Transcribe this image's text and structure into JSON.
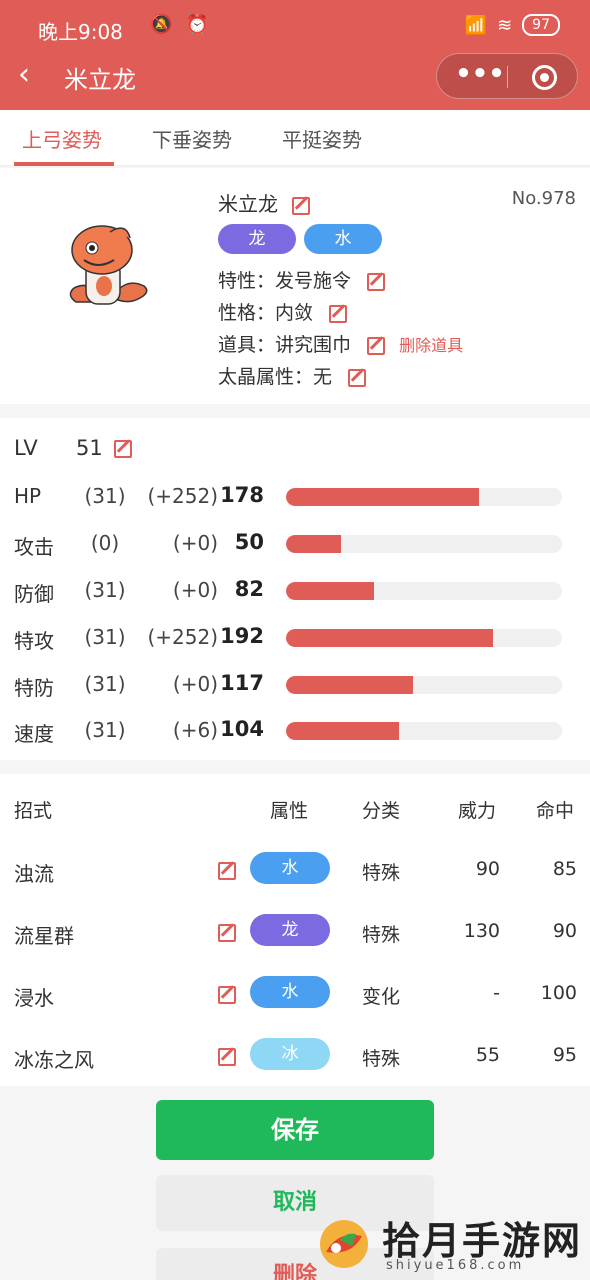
{
  "status_bar": {
    "time": "晚上9:08",
    "battery": "97"
  },
  "header": {
    "title": "米立龙"
  },
  "tabs": [
    {
      "label": "上弓姿势",
      "active": true
    },
    {
      "label": "下垂姿势",
      "active": false
    },
    {
      "label": "平挺姿势",
      "active": false
    }
  ],
  "pokemon": {
    "name": "米立龙",
    "number": "No.978",
    "types": [
      {
        "label": "龙",
        "color": "#7a6be0"
      },
      {
        "label": "水",
        "color": "#4a9ff0"
      }
    ],
    "ability": "特性：发号施令",
    "nature": "性格：内敛",
    "item": "道具：讲究围巾",
    "remove_item": "删除道具",
    "tera_type": "太晶属性：无"
  },
  "level": {
    "label": "LV",
    "value": "51"
  },
  "stats": [
    {
      "name": "HP",
      "iv": "(31)",
      "ev": "(+252)",
      "value": "178",
      "fill": 0.7
    },
    {
      "name": "攻击",
      "iv": "(0)",
      "ev": "(+0)",
      "value": "50",
      "fill": 0.2
    },
    {
      "name": "防御",
      "iv": "(31)",
      "ev": "(+0)",
      "value": "82",
      "fill": 0.32
    },
    {
      "name": "特攻",
      "iv": "(31)",
      "ev": "(+252)",
      "value": "192",
      "fill": 0.75
    },
    {
      "name": "特防",
      "iv": "(31)",
      "ev": "(+0)",
      "value": "117",
      "fill": 0.46
    },
    {
      "name": "速度",
      "iv": "(31)",
      "ev": "(+6)",
      "value": "104",
      "fill": 0.41
    }
  ],
  "moves_header": {
    "move": "招式",
    "type": "属性",
    "category": "分类",
    "power": "威力",
    "accuracy": "命中"
  },
  "moves": [
    {
      "name": "浊流",
      "type": "水",
      "type_color": "#4a9ff0",
      "category": "特殊",
      "power": "90",
      "accuracy": "85"
    },
    {
      "name": "流星群",
      "type": "龙",
      "type_color": "#7a6be0",
      "category": "特殊",
      "power": "130",
      "accuracy": "90"
    },
    {
      "name": "浸水",
      "type": "水",
      "type_color": "#4a9ff0",
      "category": "变化",
      "power": "-",
      "accuracy": "100"
    },
    {
      "name": "冰冻之风",
      "type": "冰",
      "type_color": "#8fd8f5",
      "category": "特殊",
      "power": "55",
      "accuracy": "95"
    }
  ],
  "buttons": {
    "save": "保存",
    "cancel": "取消",
    "delete": "删除"
  },
  "watermark": {
    "text": "拾月手游网",
    "url": "shiyue168.com"
  }
}
